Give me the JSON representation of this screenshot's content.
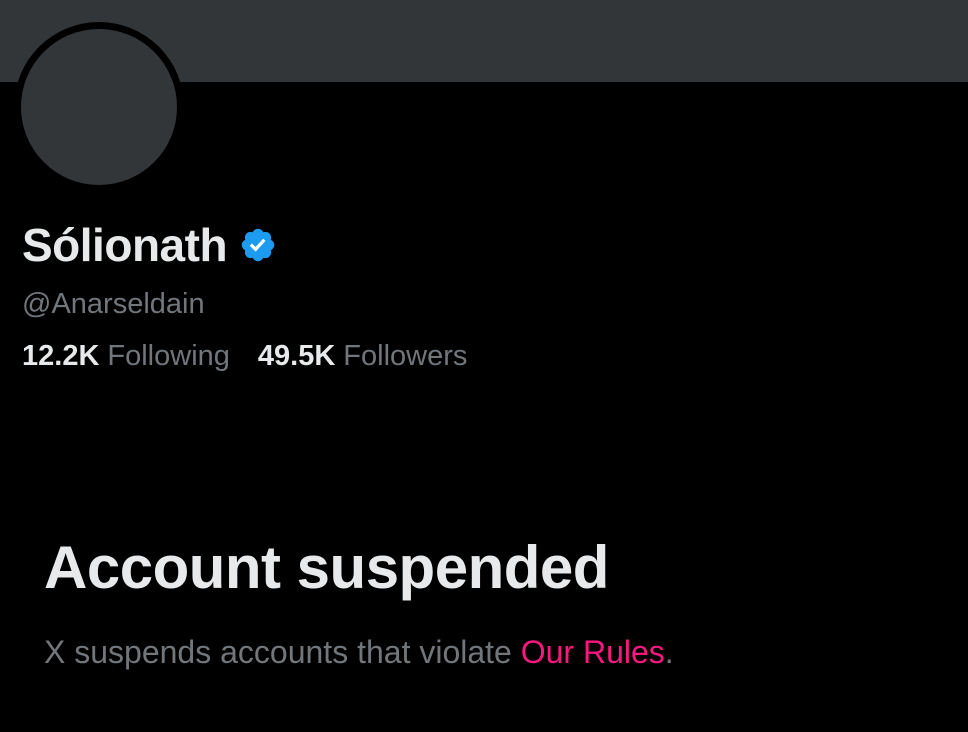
{
  "profile": {
    "display_name": "Sólionath",
    "handle": "@Anarseldain",
    "verified": true,
    "following_count": "12.2K",
    "following_label": "Following",
    "followers_count": "49.5K",
    "followers_label": "Followers"
  },
  "suspension": {
    "title": "Account suspended",
    "message": "X suspends accounts that violate ",
    "rules_link": "Our Rules",
    "message_end": "."
  },
  "colors": {
    "background": "#000000",
    "banner": "#333639",
    "verified_badge": "#1d9bf0",
    "link": "#f91880",
    "secondary_text": "#71767b"
  },
  "icons": {
    "verified": "verified-check-icon"
  }
}
